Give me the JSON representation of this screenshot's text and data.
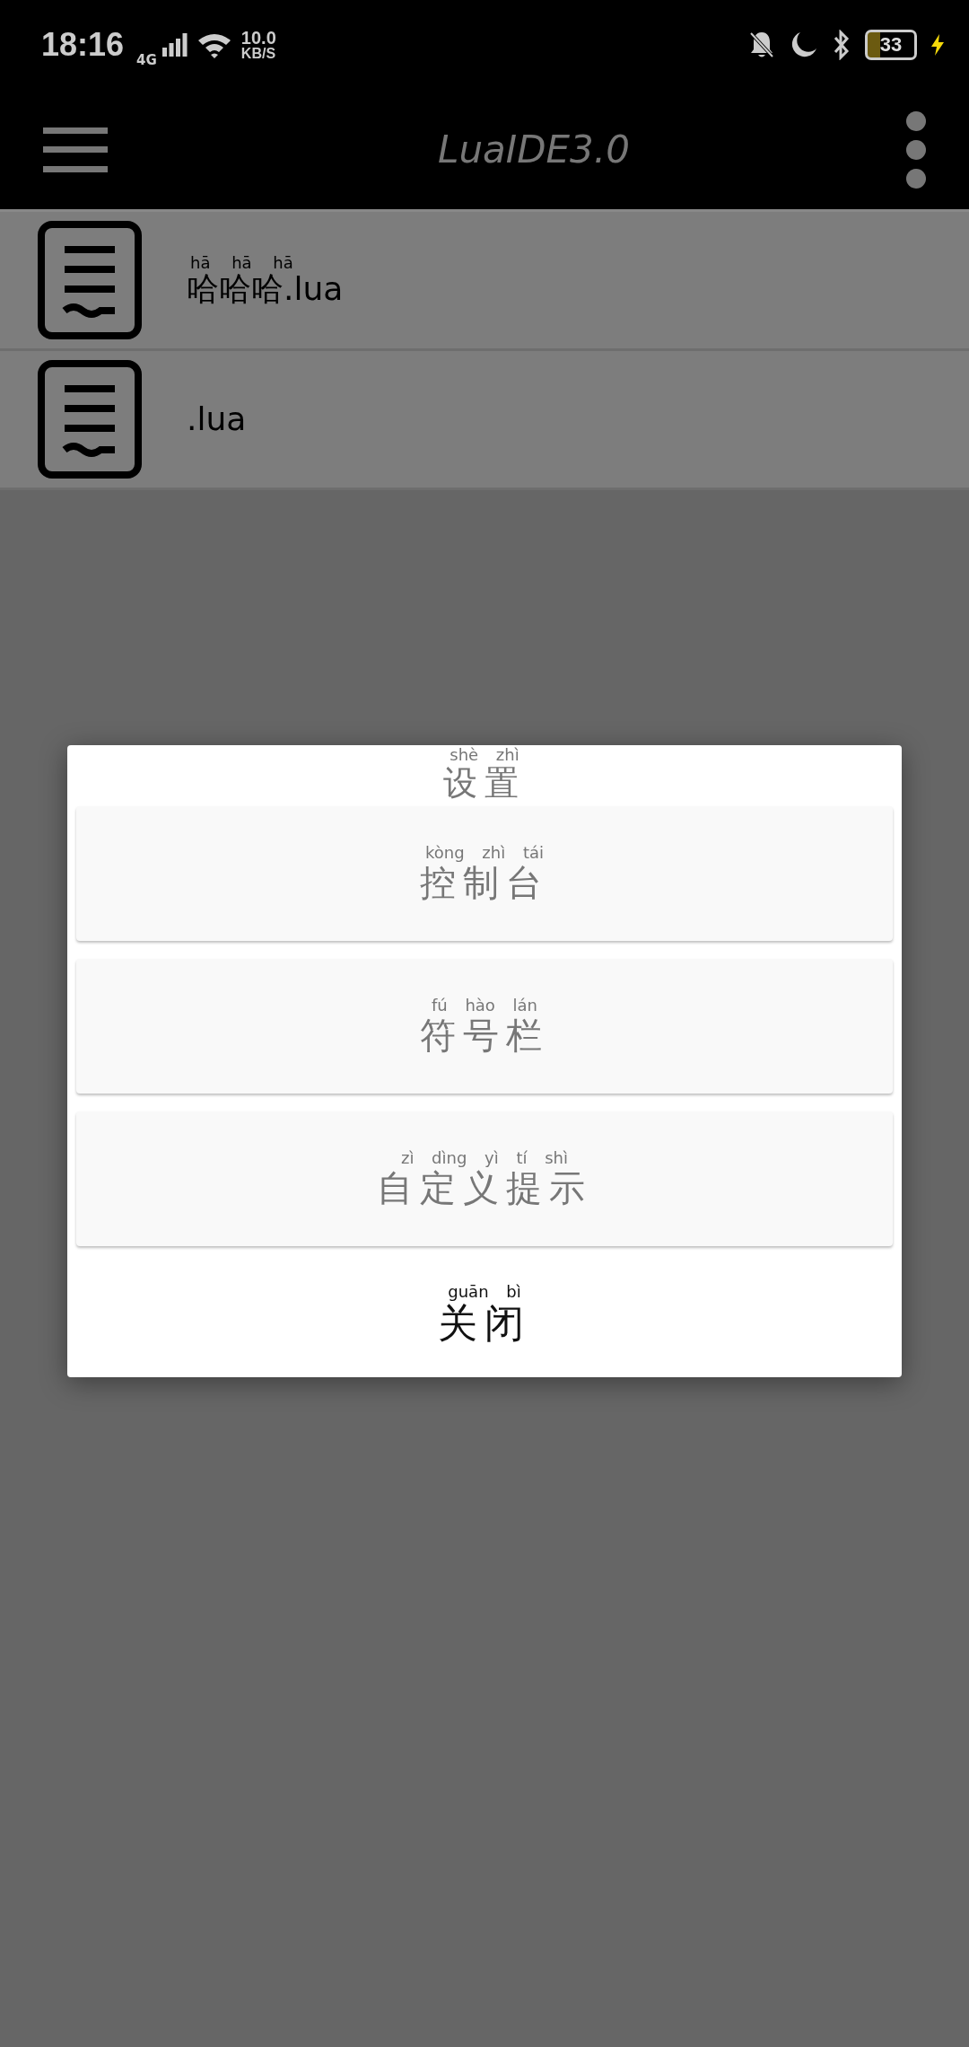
{
  "status_bar": {
    "time": "18:16",
    "network": "4G",
    "speed_value": "10.0",
    "speed_unit": "KB/S",
    "battery": "33",
    "charging": true
  },
  "app_bar": {
    "title": "LuaIDE3.0"
  },
  "files": [
    {
      "name": "哈哈哈.lua",
      "pinyin": "hā hā hā"
    },
    {
      "name": ".lua"
    }
  ],
  "dialog": {
    "title": {
      "text": "设置",
      "pinyin": "shè zhì"
    },
    "options": [
      {
        "text": "控制台",
        "pinyin": "kòng zhì tái"
      },
      {
        "text": "符号栏",
        "pinyin": "fú hào lán"
      },
      {
        "text": "自定义提示",
        "pinyin": "zì dìng yì tí shì"
      }
    ],
    "close": {
      "text": "关闭",
      "pinyin": "guān bì"
    }
  }
}
